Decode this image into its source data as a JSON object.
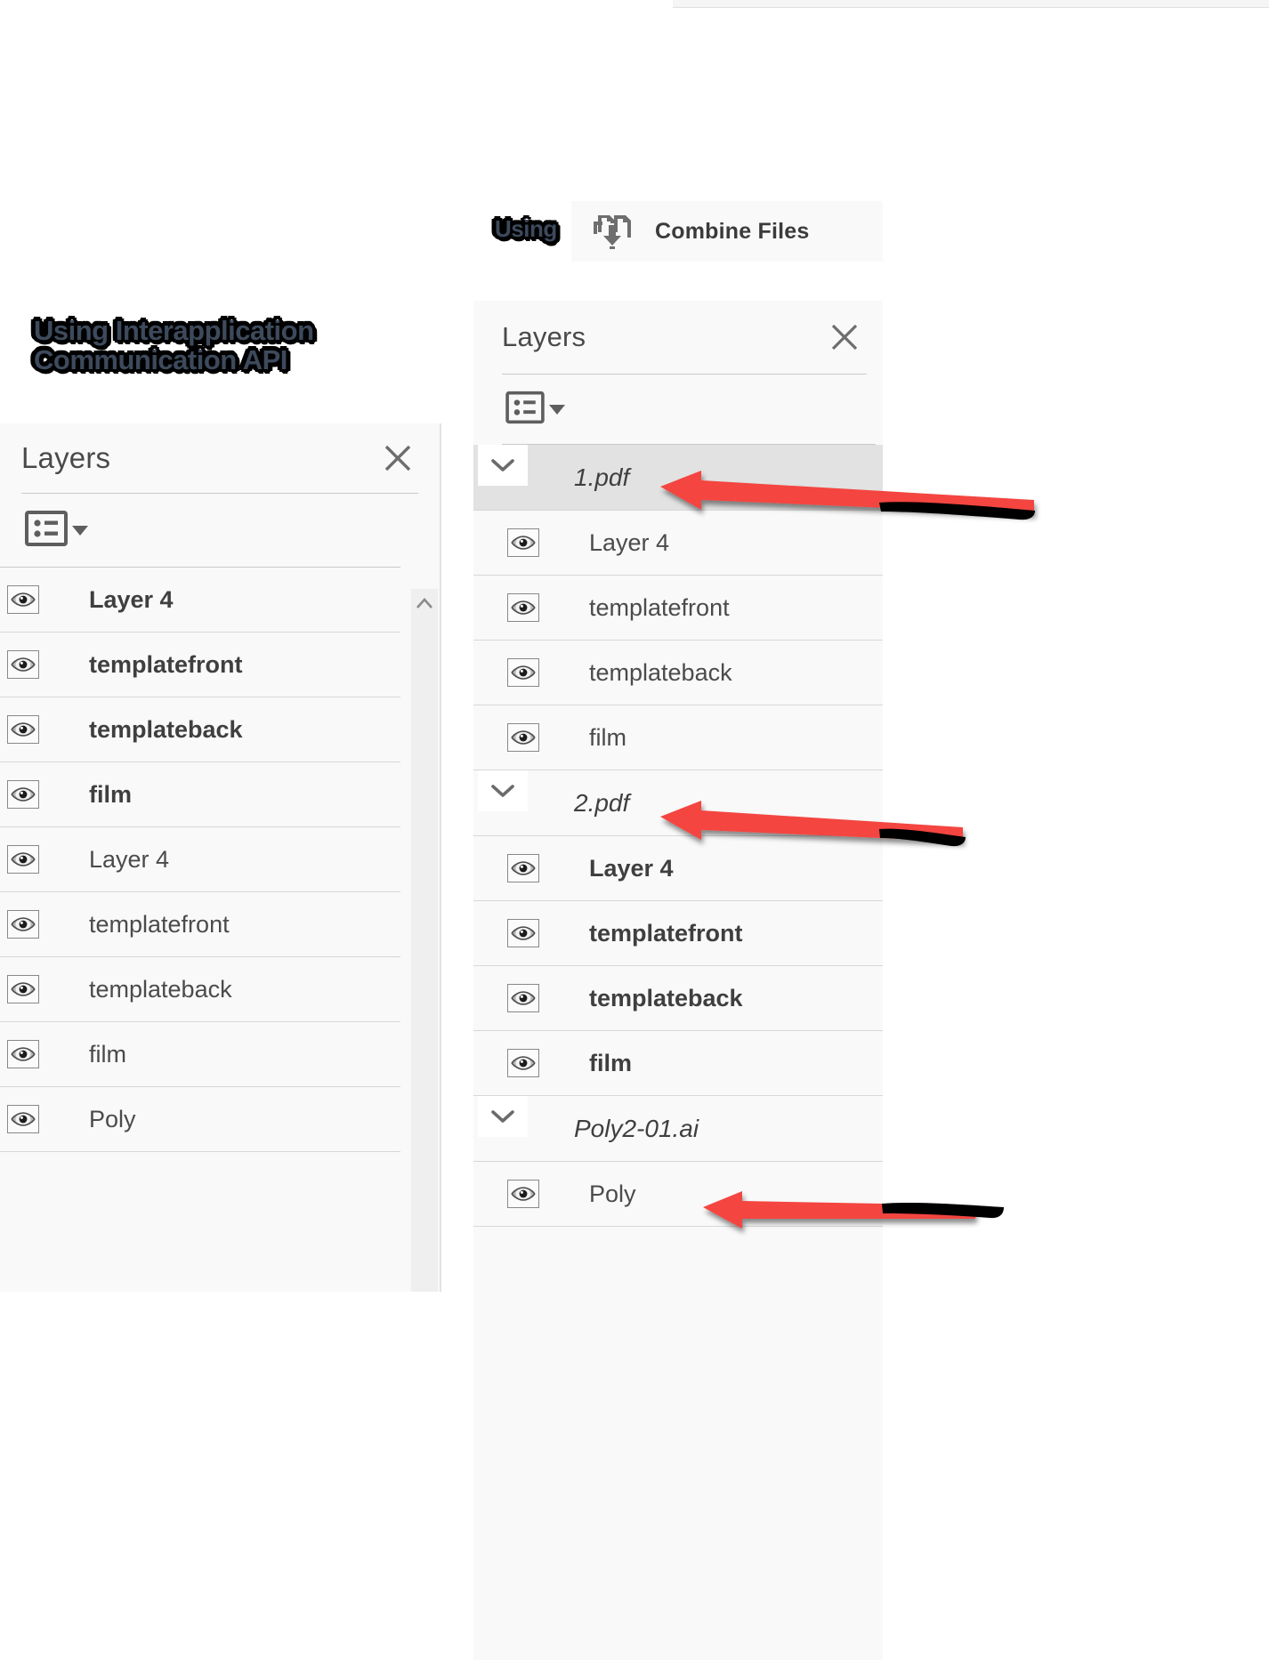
{
  "annotations": {
    "left_note": "Using Interapplication\nCommunication API",
    "right_note": "Using"
  },
  "combine_files": {
    "label": "Combine Files",
    "icon": "combine-files-icon"
  },
  "left_panel": {
    "title": "Layers",
    "close_icon": "close-icon",
    "options_icon": "layer-options-icon",
    "options_caret_icon": "chevron-down-icon",
    "scroll_up_icon": "chevron-up-icon",
    "rows": [
      {
        "name": "Layer 4",
        "bold": true,
        "eye_icon": "eye-icon"
      },
      {
        "name": "templatefront",
        "bold": true,
        "eye_icon": "eye-icon"
      },
      {
        "name": "templateback",
        "bold": true,
        "eye_icon": "eye-icon"
      },
      {
        "name": "film",
        "bold": true,
        "eye_icon": "eye-icon"
      },
      {
        "name": "Layer 4",
        "bold": false,
        "eye_icon": "eye-icon"
      },
      {
        "name": "templatefront",
        "bold": false,
        "eye_icon": "eye-icon"
      },
      {
        "name": "templateback",
        "bold": false,
        "eye_icon": "eye-icon"
      },
      {
        "name": "film",
        "bold": false,
        "eye_icon": "eye-icon"
      },
      {
        "name": "Poly",
        "bold": false,
        "eye_icon": "eye-icon"
      }
    ]
  },
  "right_panel": {
    "title": "Layers",
    "close_icon": "close-icon",
    "options_icon": "layer-options-icon",
    "options_caret_icon": "chevron-down-icon",
    "rows": [
      {
        "type": "group",
        "name": "1.pdf",
        "selected": true,
        "bold": false,
        "chevron_icon": "chevron-down-icon"
      },
      {
        "type": "layer",
        "name": "Layer 4",
        "bold": false,
        "eye_icon": "eye-icon"
      },
      {
        "type": "layer",
        "name": "templatefront",
        "bold": false,
        "eye_icon": "eye-icon"
      },
      {
        "type": "layer",
        "name": "templateback",
        "bold": false,
        "eye_icon": "eye-icon"
      },
      {
        "type": "layer",
        "name": "film",
        "bold": false,
        "eye_icon": "eye-icon"
      },
      {
        "type": "group",
        "name": "2.pdf",
        "selected": false,
        "bold": false,
        "chevron_icon": "chevron-down-icon"
      },
      {
        "type": "layer",
        "name": "Layer 4",
        "bold": true,
        "eye_icon": "eye-icon"
      },
      {
        "type": "layer",
        "name": "templatefront",
        "bold": true,
        "eye_icon": "eye-icon"
      },
      {
        "type": "layer",
        "name": "templateback",
        "bold": true,
        "eye_icon": "eye-icon"
      },
      {
        "type": "layer",
        "name": "film",
        "bold": true,
        "eye_icon": "eye-icon"
      },
      {
        "type": "group",
        "name": "Poly2-01.ai",
        "selected": false,
        "bold": false,
        "chevron_icon": "chevron-down-icon"
      },
      {
        "type": "layer",
        "name": "Poly",
        "bold": false,
        "eye_icon": "eye-icon"
      }
    ]
  },
  "arrows": [
    {
      "name": "arrow-to-1pdf",
      "color": "#F4453F"
    },
    {
      "name": "arrow-to-2pdf",
      "color": "#F4453F"
    },
    {
      "name": "arrow-to-poly",
      "color": "#F4453F"
    }
  ],
  "colors": {
    "arrow_red": "#F4453F",
    "stroke_black": "#000000",
    "panel_bg": "#f9f9f9",
    "selected_row": "#e2e2e2",
    "divider": "#d7d7d7",
    "text": "#4b4b4b"
  }
}
